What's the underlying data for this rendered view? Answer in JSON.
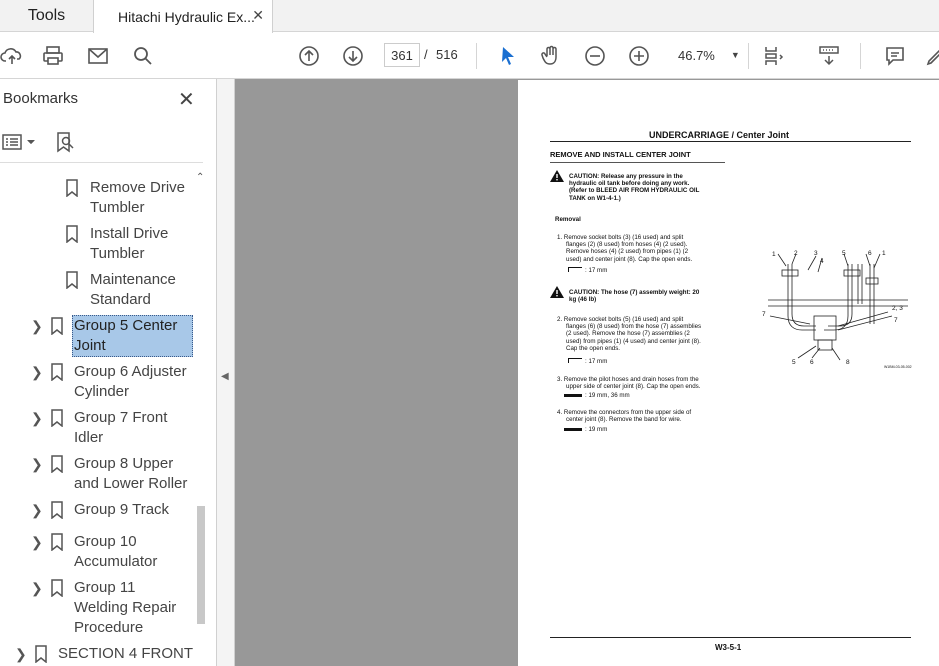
{
  "tabs": {
    "tools": "Tools",
    "document": "Hitachi Hydraulic Ex...",
    "close": "✕"
  },
  "toolbar": {
    "page_current": "361",
    "page_separator": "/",
    "page_total": "516",
    "zoom": "46.7%"
  },
  "bookmarks": {
    "title": "Bookmarks",
    "items": [
      {
        "label_1": "Remove Drive",
        "label_2": "Tumbler"
      },
      {
        "label_1": "Install Drive",
        "label_2": "Tumbler"
      },
      {
        "label_1": "Maintenance",
        "label_2": "Standard"
      },
      {
        "label_1": "Group 5 Center",
        "label_2": "Joint"
      },
      {
        "label_1": "Group 6 Adjuster",
        "label_2": "Cylinder"
      },
      {
        "label_1": "Group 7 Front",
        "label_2": "Idler"
      },
      {
        "label_1": "Group 8 Upper",
        "label_2": "and Lower Roller"
      },
      {
        "label_1": "Group 9 Track"
      },
      {
        "label_1": "Group 10",
        "label_2": "Accumulator"
      },
      {
        "label_1": "Group 11",
        "label_2": "Welding Repair",
        "label_3": "Procedure"
      },
      {
        "label_1": "SECTION 4 FRONT"
      }
    ]
  },
  "document_page": {
    "header": "UNDERCARRIAGE / Center Joint",
    "section_title": "REMOVE AND INSTALL CENTER JOINT",
    "caution_1": [
      "CAUTION: Release any pressure in the",
      "hydraulic oil tank before doing any work.",
      "(Refer to BLEED AIR FROM HYDRAULIC OIL",
      "TANK on W1-4-1.)"
    ],
    "removal_heading": "Removal",
    "step_1": [
      "1. Remove socket bolts (3) (16 used) and split",
      "flanges (2) (8 used) from hoses (4) (2 used).",
      "Remove hoses (4) (2 used) from pipes (1) (2",
      "used) and center joint (8). Cap the open ends."
    ],
    "step_1_tool": ": 17 mm",
    "caution_2": [
      "CAUTION: The hose (7) assembly weight: 20",
      "kg (46 lb)"
    ],
    "step_2": [
      "2. Remove socket bolts (5) (16 used) and split",
      "flanges (6) (8 used) from the hose (7) assemblies",
      "(2 used). Remove the hose (7) assemblies (2",
      "used) from pipes (1) (4 used) and center joint (8).",
      "Cap the open ends."
    ],
    "step_2_tool": ": 17 mm",
    "step_3": [
      "3. Remove the pilot hoses and drain hoses from the",
      "upper side of center joint (8). Cap the open ends."
    ],
    "step_3_tool": ": 19 mm, 36 mm",
    "step_4": [
      "4. Remove the connectors from the upper side of",
      "center joint (8). Remove the band for wire."
    ],
    "step_4_tool": ": 19 mm",
    "footer": "W3-5-1",
    "diagram_labels": {
      "top": [
        "1",
        "2",
        "3",
        "4",
        "5",
        "6",
        "1"
      ],
      "left": "7",
      "right_23": "2, 3",
      "right_7": "7",
      "bottom": [
        "5",
        "6",
        "8"
      ],
      "code": "W1BM-03-05-002"
    }
  }
}
